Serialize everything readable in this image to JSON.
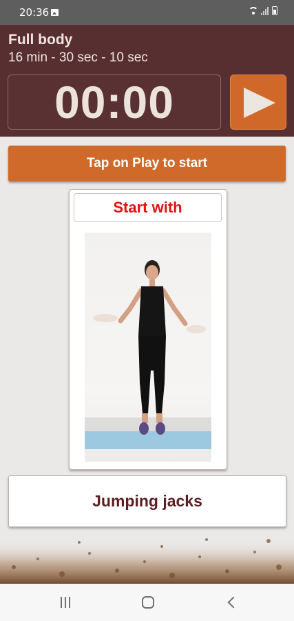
{
  "status_bar": {
    "time": "20:36",
    "icons": [
      "image-icon",
      "wifi-icon",
      "signal-icon",
      "battery-icon"
    ]
  },
  "workout": {
    "title": "Full body",
    "subtitle": "16 min - 30 sec - 10 sec",
    "timer": "00:00",
    "play_icon": "play-icon"
  },
  "banner": {
    "text": "Tap on Play to start"
  },
  "exercise": {
    "start_label": "Start with",
    "name": "Jumping jacks"
  },
  "nav_bar": {
    "icons": [
      "recent-apps-icon",
      "home-icon",
      "back-icon"
    ]
  },
  "colors": {
    "header_bg": "#582f31",
    "accent_orange": "#d06a2b",
    "start_red": "#e01212",
    "exercise_text": "#5b1e21"
  }
}
